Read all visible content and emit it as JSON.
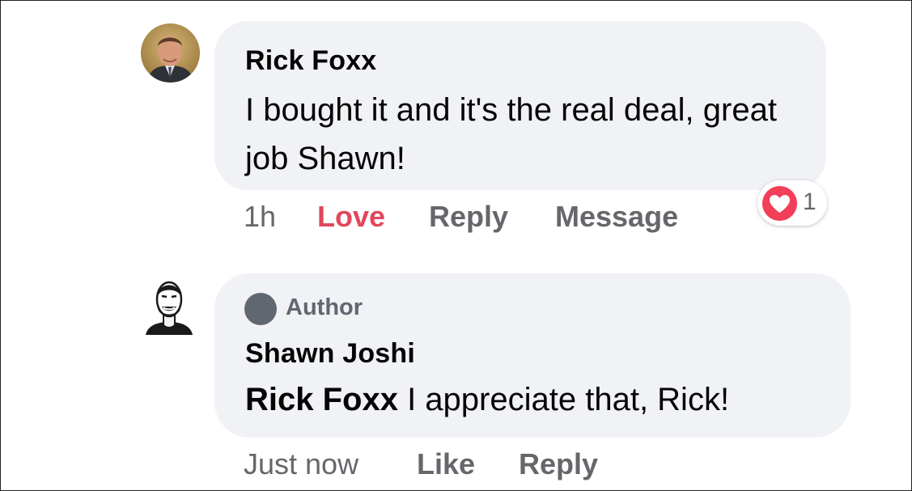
{
  "comments": [
    {
      "author": "Rick Foxx",
      "text": "I bought it and it's the real deal, great job Shawn!",
      "time": "1h",
      "actions": {
        "love": "Love",
        "reply": "Reply",
        "message": "Message"
      },
      "reactions": {
        "icon": "heart-reaction-icon",
        "count": "1"
      },
      "avatar_icon": "avatar-rick-foxx"
    },
    {
      "badge": "Author",
      "author": "Shawn Joshi",
      "mention": "Rick Foxx",
      "text": " I appreciate that, Rick!",
      "time": "Just now",
      "actions": {
        "like": "Like",
        "reply": "Reply"
      },
      "avatar_icon": "avatar-shawn-joshi"
    }
  ],
  "colors": {
    "bubble": "#f0f2f5",
    "love": "#e0475c",
    "muted": "#65676b",
    "heart": "#f33e58"
  }
}
